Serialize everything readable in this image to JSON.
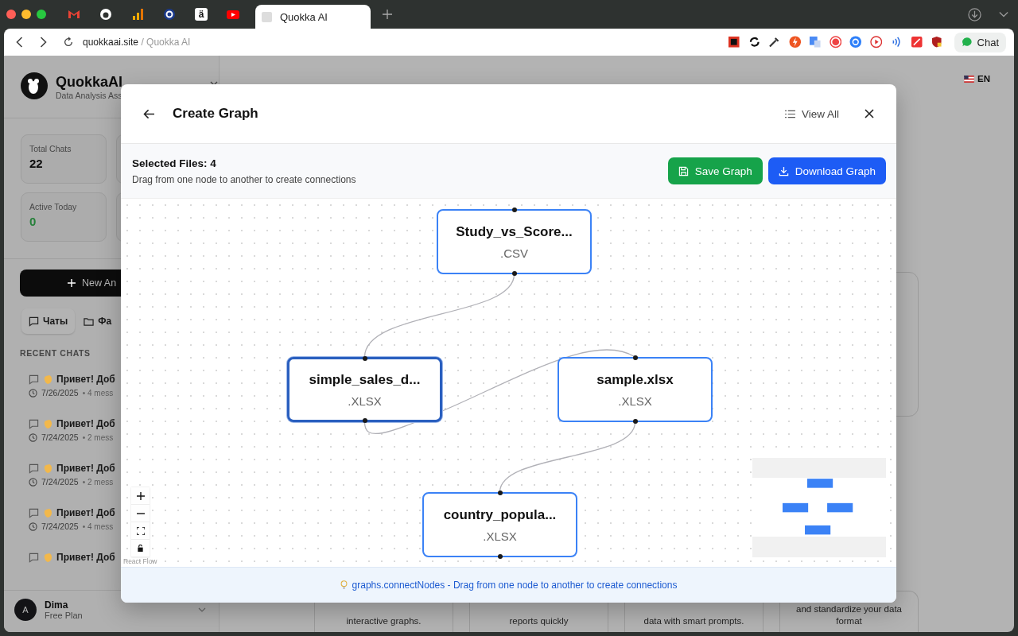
{
  "browser": {
    "pinned_tab_letter": "ä",
    "tabs": [
      {
        "label": "Quokka AI",
        "selected": true
      }
    ],
    "address": {
      "domain": "quokkaai.site",
      "path": "/ Quokka AI"
    },
    "chat_button": "Chat"
  },
  "sidebar": {
    "brand": "QuokkaAI",
    "subtitle": "Data Analysis Ass",
    "stats": [
      {
        "label": "Total Chats",
        "value": "22",
        "color": "#0c0c0c"
      },
      {
        "label": "Active Today",
        "value": "0",
        "color": "#26803a"
      }
    ],
    "new_button": "New An",
    "tabs": [
      {
        "label": "Чаты",
        "selected": true
      },
      {
        "label": "Фа",
        "selected": false
      }
    ],
    "recent_heading": "RECENT CHATS",
    "chats": [
      {
        "title": "Привет! Доб",
        "date": "7/26/2025",
        "meta": "• 4 mess"
      },
      {
        "title": "Привет! Доб",
        "date": "7/24/2025",
        "meta": "• 2 mess"
      },
      {
        "title": "Привет! Доб",
        "date": "7/24/2025",
        "meta": "• 2 mess"
      },
      {
        "title": "Привет! Доб",
        "date": "7/24/2025",
        "meta": "• 4 mess"
      },
      {
        "title": "Привет! Доб"
      }
    ],
    "user": {
      "initial": "A",
      "name": "Dima",
      "plan": "Free Plan"
    }
  },
  "main": {
    "language": "EN",
    "feature_cards": [
      {
        "text": "interactive graphs."
      },
      {
        "text": "reports quickly"
      },
      {
        "text": "data with smart prompts."
      },
      {
        "text": "and standardize your data format"
      }
    ]
  },
  "modal": {
    "title": "Create Graph",
    "view_all": "View All",
    "selected_files": "Selected Files: 4",
    "hint": "Drag from one node to another to create connections",
    "save_button": "Save Graph",
    "download_button": "Download Graph",
    "nodes": [
      {
        "name": "Study_vs_Score...",
        "ext": ".CSV",
        "selected": false
      },
      {
        "name": "simple_sales_d...",
        "ext": ".XLSX",
        "selected": true
      },
      {
        "name": "sample.xlsx",
        "ext": ".XLSX",
        "selected": false
      },
      {
        "name": "country_popula...",
        "ext": ".XLSX",
        "selected": false
      }
    ],
    "attribution": "React Flow",
    "footer": "graphs.connectNodes - Drag from one node to another to create connections"
  }
}
